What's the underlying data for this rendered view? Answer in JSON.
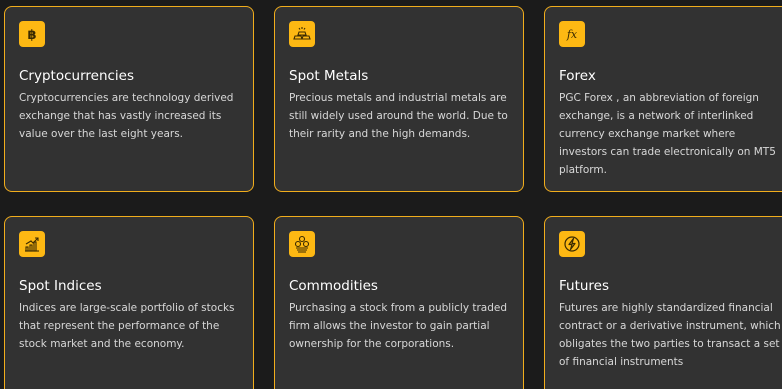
{
  "colors": {
    "background": "#1b1b1b",
    "card": "#323232",
    "accent": "#f1ad1c",
    "icon_bg": "#fdb813"
  },
  "cards": [
    {
      "icon": "bitcoin-icon",
      "title": "Cryptocurrencies",
      "description": "Cryptocurrencies are technology derived exchange that has vastly increased its value over the last eight years."
    },
    {
      "icon": "gold-bars-icon",
      "title": "Spot Metals",
      "description": "Precious metals and industrial metals are still widely used around the world. Due to their rarity and the high demands."
    },
    {
      "icon": "fx-icon",
      "title": "Forex",
      "description": "PGC Forex , an abbreviation of foreign exchange, is a network of interlinked currency exchange market where investors can trade electronically on MT5 platform."
    },
    {
      "icon": "chart-growth-icon",
      "title": "Spot Indices",
      "description": "Indices are large-scale portfolio of stocks that represent the performance of the stock market and the economy."
    },
    {
      "icon": "coins-icon",
      "title": "Commodities",
      "description": "Purchasing a stock from a publicly traded firm allows the investor to gain partial ownership for the corporations."
    },
    {
      "icon": "lightning-icon",
      "title": "Futures",
      "description": "Futures are highly standardized financial contract or a derivative instrument, which obligates the two parties to transact a set of financial instruments"
    }
  ]
}
